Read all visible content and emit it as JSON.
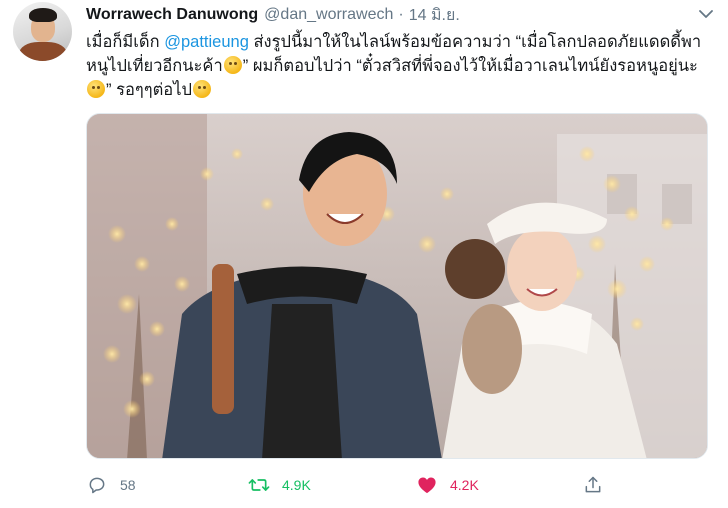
{
  "tweet": {
    "display_name": "Worrawech Danuwong",
    "handle": "@dan_worrawech",
    "separator": "·",
    "date": "14 มิ.ย.",
    "text": {
      "seg1": "เมื่อก็มีเด็ก ",
      "mention": "@pattieung",
      "seg2": " ส่งรูปนี้มาให้ในไลน์พร้อมข้อความว่า “เมื่อโลกปลอดภัยแดดดี้พาหนูไปเที่ยวอีกนะค้า",
      "seg3": "” ผมก็ตอบไปว่า “ตั๋วสวิสที่พี่จองไว้ให้เมื่อวาเลนไทน์ยังรอหนูอยู่นะ",
      "seg4": "” รอๆๆต่อไป"
    },
    "emojis": [
      "smiling-face-emoji",
      "grinning-squinting-face-emoji",
      "grinning-face-sweat-emoji"
    ],
    "image": {
      "subject": "photo-couple-winter-lights"
    },
    "actions": {
      "reply_count": "58",
      "retweet_count": "4.9K",
      "like_count": "4.2K"
    },
    "icons": {
      "caret": "chevron-down-icon",
      "reply": "reply-icon",
      "retweet": "retweet-icon",
      "like": "heart-icon",
      "share": "share-icon"
    },
    "colors": {
      "text": "#14171a",
      "secondary": "#657786",
      "link": "#1b95e0",
      "retweet": "#17bf63",
      "like": "#e0245e"
    }
  }
}
